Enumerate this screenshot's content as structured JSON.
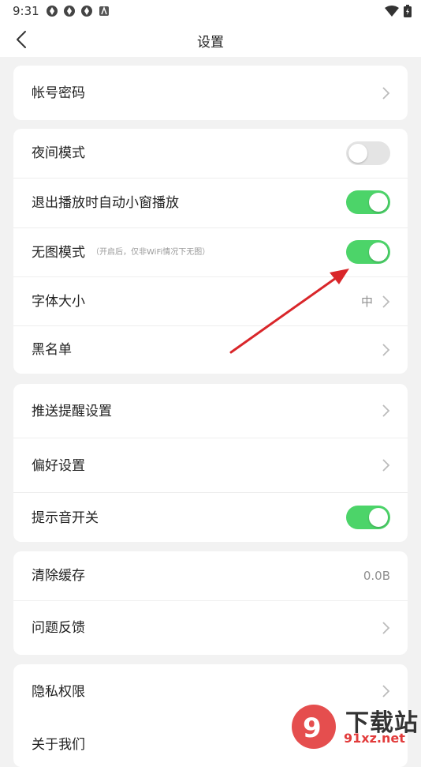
{
  "status": {
    "time": "9:31"
  },
  "nav": {
    "title": "设置"
  },
  "groups": {
    "account": {
      "account_password": "帐号密码"
    },
    "display": {
      "night_mode": "夜间模式",
      "night_mode_on": false,
      "auto_pip": "退出播放时自动小窗播放",
      "auto_pip_on": true,
      "no_image": "无图模式",
      "no_image_note": "（开启后，仅非WiFi情况下无图）",
      "no_image_on": true,
      "font_size": "字体大小",
      "font_size_value": "中",
      "blacklist": "黑名单"
    },
    "notify": {
      "push": "推送提醒设置",
      "preference": "偏好设置",
      "sound": "提示音开关",
      "sound_on": true
    },
    "storage": {
      "clear_cache": "清除缓存",
      "cache_size": "0.0B",
      "feedback": "问题反馈"
    },
    "about": {
      "privacy": "隐私权限",
      "about_us": "关于我们"
    }
  },
  "watermark": {
    "title": "下载站",
    "url": "91xz.net"
  },
  "colors": {
    "toggle_on": "#4cd469",
    "toggle_off": "#e4e4e4",
    "annotation_arrow": "#d9262a"
  }
}
